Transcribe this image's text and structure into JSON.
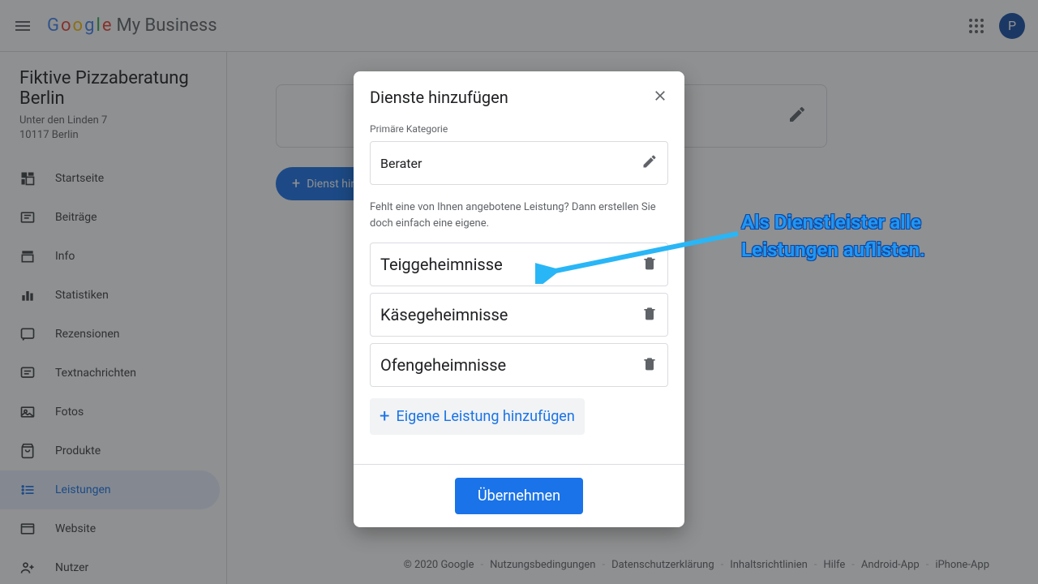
{
  "header": {
    "product_suffix": "My Business",
    "avatar_letter": "P"
  },
  "business": {
    "title": "Fiktive Pizzaberatung Berlin",
    "address1": "Unter den Linden 7",
    "address2": "10117 Berlin"
  },
  "sidebar": {
    "items": [
      {
        "label": "Startseite"
      },
      {
        "label": "Beiträge"
      },
      {
        "label": "Info"
      },
      {
        "label": "Statistiken"
      },
      {
        "label": "Rezensionen"
      },
      {
        "label": "Textnachrichten"
      },
      {
        "label": "Fotos"
      },
      {
        "label": "Produkte"
      },
      {
        "label": "Leistungen"
      },
      {
        "label": "Website"
      },
      {
        "label": "Nutzer"
      }
    ],
    "active_index": 8
  },
  "content": {
    "add_service_button": "Dienst hinzufügen"
  },
  "dialog": {
    "title": "Dienste hinzufügen",
    "category_label": "Primäre Kategorie",
    "category_value": "Berater",
    "helper_text": "Fehlt eine von Ihnen angebotene Leistung? Dann erstellen Sie doch einfach eine eigene.",
    "services": [
      {
        "name": "Teiggeheimnisse"
      },
      {
        "name": "Käsegeheimnisse"
      },
      {
        "name": "Ofengeheimnisse"
      }
    ],
    "add_own_label": "Eigene Leistung hinzufügen",
    "submit_label": "Übernehmen"
  },
  "annotation": {
    "line1": "Als Dienstleister alle",
    "line2": "Leistungen auflisten."
  },
  "footer": {
    "copyright": "© 2020 Google",
    "links": [
      "Nutzungsbedingungen",
      "Datenschutzerklärung",
      "Inhaltsrichtlinien",
      "Hilfe",
      "Android-App",
      "iPhone-App"
    ]
  }
}
